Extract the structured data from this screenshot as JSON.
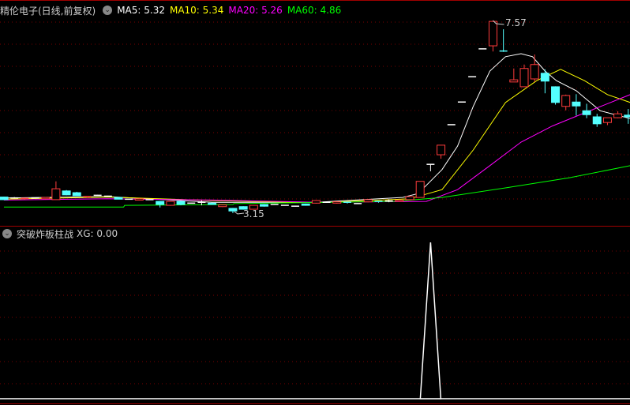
{
  "main_panel": {
    "stock_title": "精伦电子(日线,前复权)",
    "menu_icon": "chevron-down-circle-icon",
    "ma_labels": [
      {
        "text": "MA5: 5.32",
        "color": "#ffffff"
      },
      {
        "text": "MA10: 5.34",
        "color": "#ffff00"
      },
      {
        "text": "MA20: 5.26",
        "color": "#ff00ff"
      },
      {
        "text": "MA60: 4.86",
        "color": "#00ff00"
      }
    ],
    "high_label": "7.57",
    "low_label": "3.15",
    "high_index": 47,
    "low_index": 22,
    "price_top": 7.57,
    "price_bottom": 3.15
  },
  "indicator_panel": {
    "title": "突破炸板柱战",
    "value_label": "XG: 0.00",
    "menu_icon": "chevron-down-circle-icon"
  },
  "colors": {
    "up": "#ff3c3c",
    "down": "#54ffff",
    "flat": "#ffffff",
    "grid": "#7a0000",
    "border": "#a00000"
  },
  "chart_data": {
    "type": "candlestick",
    "candles_ohlc": [
      [
        3.52,
        3.53,
        3.45,
        3.46
      ],
      [
        3.5,
        3.52,
        3.49,
        3.5
      ],
      [
        3.47,
        3.5,
        3.46,
        3.49
      ],
      [
        3.5,
        3.51,
        3.49,
        3.5
      ],
      [
        3.48,
        3.52,
        3.47,
        3.51
      ],
      [
        3.46,
        3.88,
        3.46,
        3.71
      ],
      [
        3.66,
        3.68,
        3.56,
        3.57
      ],
      [
        3.62,
        3.64,
        3.55,
        3.55
      ],
      [
        3.51,
        3.54,
        3.5,
        3.53
      ],
      [
        3.56,
        3.57,
        3.55,
        3.56
      ],
      [
        3.54,
        3.55,
        3.53,
        3.54
      ],
      [
        3.51,
        3.52,
        3.47,
        3.47
      ],
      [
        3.47,
        3.48,
        3.46,
        3.47
      ],
      [
        3.45,
        3.49,
        3.44,
        3.48
      ],
      [
        3.46,
        3.47,
        3.45,
        3.46
      ],
      [
        3.42,
        3.43,
        3.28,
        3.35
      ],
      [
        3.33,
        3.43,
        3.32,
        3.42
      ],
      [
        3.42,
        3.43,
        3.33,
        3.35
      ],
      [
        3.38,
        3.39,
        3.37,
        3.38
      ],
      [
        3.4,
        3.44,
        3.33,
        3.4
      ],
      [
        3.38,
        3.39,
        3.34,
        3.35
      ],
      [
        3.3,
        3.35,
        3.29,
        3.34
      ],
      [
        3.26,
        3.27,
        3.15,
        3.2
      ],
      [
        3.3,
        3.31,
        3.23,
        3.24
      ],
      [
        3.24,
        3.34,
        3.23,
        3.33
      ],
      [
        3.35,
        3.36,
        3.3,
        3.31
      ],
      [
        3.35,
        3.36,
        3.34,
        3.35
      ],
      [
        3.33,
        3.34,
        3.32,
        3.33
      ],
      [
        3.31,
        3.32,
        3.3,
        3.31
      ],
      [
        3.36,
        3.37,
        3.32,
        3.33
      ],
      [
        3.38,
        3.45,
        3.37,
        3.44
      ],
      [
        3.4,
        3.41,
        3.39,
        3.4
      ],
      [
        3.38,
        3.42,
        3.37,
        3.41
      ],
      [
        3.4,
        3.41,
        3.37,
        3.38
      ],
      [
        3.37,
        3.38,
        3.36,
        3.37
      ],
      [
        3.41,
        3.47,
        3.4,
        3.46
      ],
      [
        3.42,
        3.43,
        3.39,
        3.4
      ],
      [
        3.43,
        3.47,
        3.4,
        3.43
      ],
      [
        3.42,
        3.46,
        3.41,
        3.45
      ],
      [
        3.46,
        3.55,
        3.45,
        3.53
      ],
      [
        3.51,
        3.88,
        3.51,
        3.88
      ],
      [
        4.27,
        4.27,
        4.11,
        4.27
      ],
      [
        4.49,
        4.71,
        4.4,
        4.71
      ],
      [
        5.18,
        5.18,
        5.18,
        5.18
      ],
      [
        5.7,
        5.7,
        5.7,
        5.7
      ],
      [
        6.28,
        6.28,
        6.28,
        6.28
      ],
      [
        6.92,
        6.92,
        6.92,
        6.92
      ],
      [
        6.99,
        7.57,
        6.86,
        7.55
      ],
      [
        6.87,
        7.37,
        6.85,
        6.85
      ],
      [
        6.16,
        6.47,
        6.16,
        6.21
      ],
      [
        6.05,
        6.56,
        6.05,
        6.47
      ],
      [
        6.23,
        6.79,
        6.16,
        6.56
      ],
      [
        6.36,
        6.45,
        5.9,
        6.18
      ],
      [
        6.05,
        6.06,
        5.64,
        5.69
      ],
      [
        5.6,
        5.87,
        5.51,
        5.85
      ],
      [
        5.7,
        5.88,
        5.39,
        5.61
      ],
      [
        5.5,
        5.66,
        5.33,
        5.41
      ],
      [
        5.36,
        5.43,
        5.13,
        5.2
      ],
      [
        5.23,
        5.34,
        5.17,
        5.34
      ],
      [
        5.34,
        5.49,
        5.33,
        5.43
      ],
      [
        5.4,
        5.54,
        5.2,
        5.36
      ]
    ],
    "ma_series": [
      {
        "name": "MA5",
        "color": "#ffffff",
        "points": [
          [
            0,
            3.5
          ],
          [
            10,
            3.53
          ],
          [
            20,
            3.4
          ],
          [
            30,
            3.4
          ],
          [
            38.3,
            3.51
          ],
          [
            39.8,
            3.6
          ],
          [
            42.1,
            4.15
          ],
          [
            43.6,
            4.69
          ],
          [
            45.1,
            5.6
          ],
          [
            46.7,
            6.41
          ],
          [
            48.2,
            6.74
          ],
          [
            49.7,
            6.81
          ],
          [
            50.8,
            6.74
          ],
          [
            52,
            6.41
          ],
          [
            53.1,
            6.19
          ],
          [
            55,
            5.96
          ],
          [
            57.3,
            5.5
          ],
          [
            60.2,
            5.32
          ]
        ]
      },
      {
        "name": "MA10",
        "color": "#ffff00",
        "points": [
          [
            0,
            3.47
          ],
          [
            10,
            3.52
          ],
          [
            20,
            3.44
          ],
          [
            30,
            3.39
          ],
          [
            39,
            3.48
          ],
          [
            42.1,
            3.69
          ],
          [
            45.1,
            4.6
          ],
          [
            48.2,
            5.69
          ],
          [
            51.2,
            6.19
          ],
          [
            53.5,
            6.45
          ],
          [
            55.8,
            6.19
          ],
          [
            58,
            5.87
          ],
          [
            60.2,
            5.69
          ]
        ]
      },
      {
        "name": "MA20",
        "color": "#ff00ff",
        "points": [
          [
            0,
            3.45
          ],
          [
            10,
            3.48
          ],
          [
            20,
            3.45
          ],
          [
            30,
            3.4
          ],
          [
            40.6,
            3.42
          ],
          [
            43.6,
            3.69
          ],
          [
            46.7,
            4.24
          ],
          [
            49.7,
            4.78
          ],
          [
            52.7,
            5.15
          ],
          [
            55.8,
            5.45
          ],
          [
            60.2,
            5.87
          ]
        ]
      },
      {
        "name": "MA60",
        "color": "#00ff00",
        "points": [
          [
            0,
            3.29
          ],
          [
            11.5,
            3.29
          ],
          [
            11.6,
            3.33
          ],
          [
            22,
            3.35
          ],
          [
            22.1,
            3.37
          ],
          [
            37.5,
            3.42
          ],
          [
            42.1,
            3.51
          ],
          [
            48.2,
            3.73
          ],
          [
            54.3,
            3.96
          ],
          [
            60.2,
            4.24
          ]
        ]
      }
    ],
    "xg_values_nonzero": [
      {
        "index": 41,
        "value": 1
      }
    ]
  }
}
